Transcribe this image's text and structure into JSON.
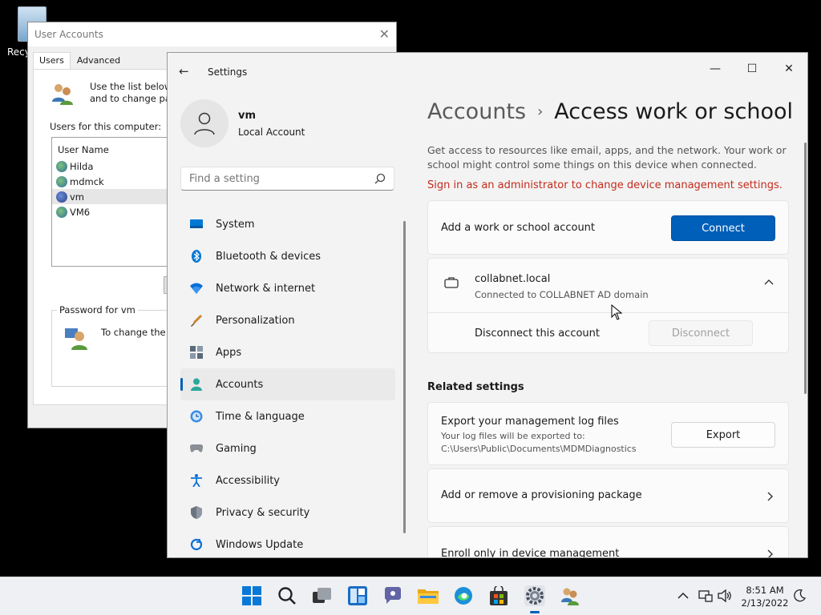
{
  "desktop": {
    "recycle_label": "Recy"
  },
  "user_accounts": {
    "title": "User Accounts",
    "tabs": [
      "Users",
      "Advanced"
    ],
    "description_line1": "Use the list below to",
    "description_line2": "and to change pass",
    "list_label": "Users for this computer:",
    "column_header": "User Name",
    "users": [
      "Hilda",
      "mdmck",
      "vm",
      "VM6"
    ],
    "password_group": "Password for vm",
    "password_text": "To change the pa"
  },
  "settings": {
    "app_title": "Settings",
    "profile": {
      "name": "vm",
      "type": "Local Account"
    },
    "search_placeholder": "Find a setting",
    "nav": [
      {
        "label": "System",
        "icon": "system-icon"
      },
      {
        "label": "Bluetooth & devices",
        "icon": "bluetooth-icon"
      },
      {
        "label": "Network & internet",
        "icon": "network-icon"
      },
      {
        "label": "Personalization",
        "icon": "brush-icon"
      },
      {
        "label": "Apps",
        "icon": "apps-icon"
      },
      {
        "label": "Accounts",
        "icon": "accounts-icon"
      },
      {
        "label": "Time & language",
        "icon": "clock-icon"
      },
      {
        "label": "Gaming",
        "icon": "gamepad-icon"
      },
      {
        "label": "Accessibility",
        "icon": "accessibility-icon"
      },
      {
        "label": "Privacy & security",
        "icon": "shield-icon"
      },
      {
        "label": "Windows Update",
        "icon": "update-icon"
      }
    ],
    "breadcrumb": {
      "parent": "Accounts",
      "separator": "›",
      "current": "Access work or school"
    },
    "description": "Get access to resources like email, apps, and the network. Your work or school might control some things on this device when connected.",
    "warning": "Sign in as an administrator to change device management settings.",
    "add_account": {
      "label": "Add a work or school account",
      "button": "Connect"
    },
    "connected_account": {
      "name": "collabnet.local",
      "subtitle": "Connected to COLLABNET AD domain",
      "disconnect_label": "Disconnect this account",
      "disconnect_button": "Disconnect"
    },
    "related_title": "Related settings",
    "export": {
      "title": "Export your management log files",
      "subtitle": "Your log files will be exported to: C:\\Users\\Public\\Documents\\MDMDiagnostics",
      "button": "Export"
    },
    "provisioning": "Add or remove a provisioning package",
    "enroll": "Enroll only in device management"
  },
  "taskbar": {
    "time": "8:51 AM",
    "date": "2/13/2022"
  },
  "colors": {
    "accent": "#005fb8",
    "warning": "#c42b1c"
  }
}
